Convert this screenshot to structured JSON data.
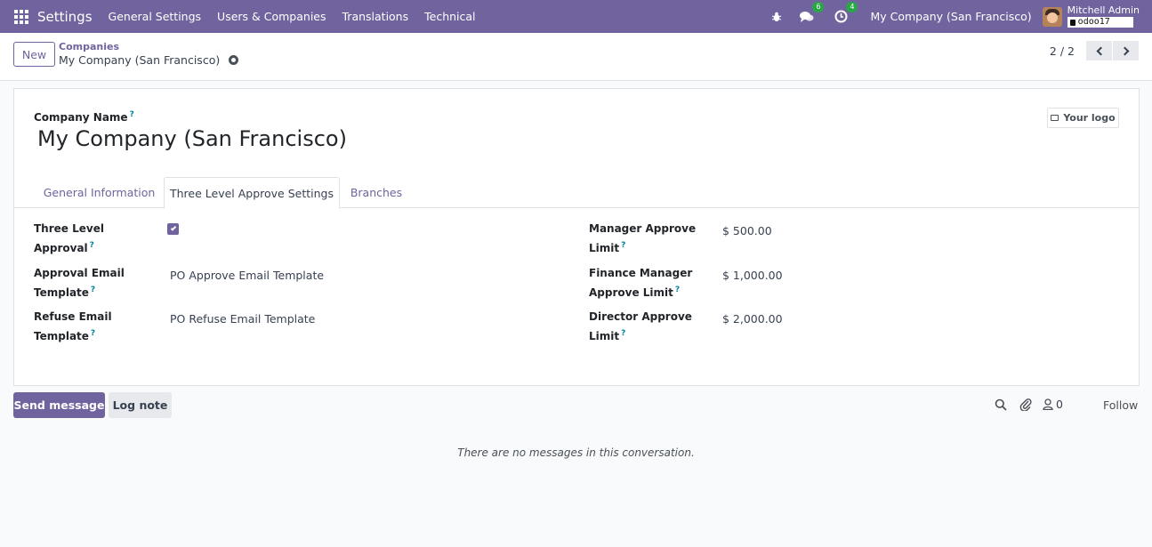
{
  "navbar": {
    "app_name": "Settings",
    "menu": [
      "General Settings",
      "Users & Companies",
      "Translations",
      "Technical"
    ],
    "messages_count": "6",
    "activities_count": "4",
    "company": "My Company (San Francisco)",
    "user_name": "Mitchell Admin",
    "db_name": "odoo17"
  },
  "control": {
    "new_label": "New",
    "breadcrumb_parent": "Companies",
    "breadcrumb_current": "My Company (San Francisco)",
    "pager": "2 / 2"
  },
  "form": {
    "company_name_label": "Company Name",
    "company_name": "My Company (San Francisco)",
    "logo_label": "Your logo",
    "tabs": [
      "General Information",
      "Three Level Approve Settings",
      "Branches"
    ],
    "active_tab": "Three Level Approve Settings",
    "left_fields": [
      {
        "label": "Three Level Approval",
        "value": true
      },
      {
        "label": "Approval Email Template",
        "value": "PO Approve Email Template"
      },
      {
        "label": "Refuse Email Template",
        "value": "PO Refuse Email Template"
      }
    ],
    "right_fields": [
      {
        "label": "Manager Approve Limit",
        "value": "$ 500.00"
      },
      {
        "label": "Finance Manager Approve Limit",
        "value": "$ 1,000.00"
      },
      {
        "label": "Director Approve Limit",
        "value": "$ 2,000.00"
      }
    ]
  },
  "chatter": {
    "send_message": "Send message",
    "log_note": "Log note",
    "followers_count": "0",
    "follow": "Follow",
    "empty_text": "There are no messages in this conversation."
  },
  "colors": {
    "brand": "#71639e",
    "badge": "#28a745",
    "help": "#0180a5"
  }
}
